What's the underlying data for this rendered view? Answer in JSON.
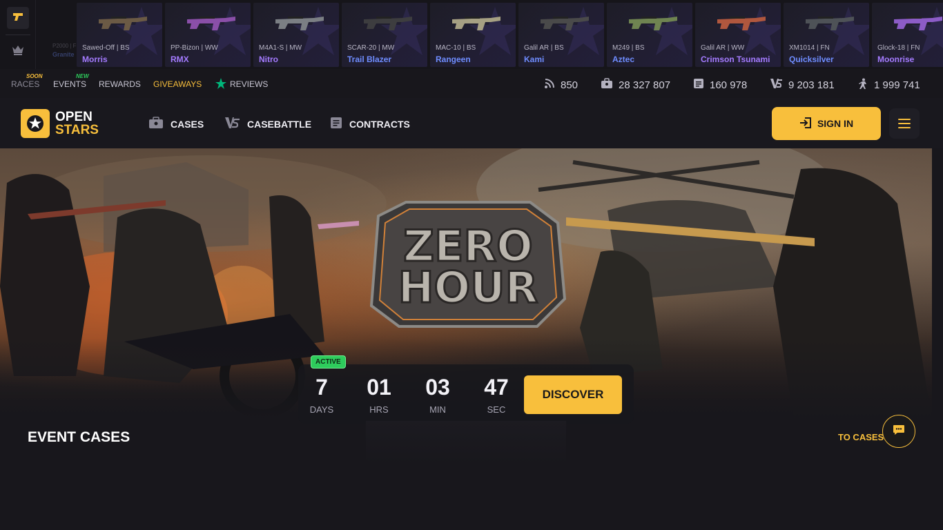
{
  "drops": [
    {
      "condition": "Sawed-Off | BS",
      "name": "Morris",
      "color": "#a47bff"
    },
    {
      "condition": "PP-Bizon | WW",
      "name": "RMX",
      "color": "#a47bff"
    },
    {
      "condition": "M4A1-S | MW",
      "name": "Nitro",
      "color": "#a47bff"
    },
    {
      "condition": "SCAR-20 | MW",
      "name": "Trail Blazer",
      "color": "#6f8dff"
    },
    {
      "condition": "MAC-10 | BS",
      "name": "Rangeen",
      "color": "#6f8dff"
    },
    {
      "condition": "Galil AR | BS",
      "name": "Kami",
      "color": "#6f8dff"
    },
    {
      "condition": "M249 | BS",
      "name": "Aztec",
      "color": "#6f8dff"
    },
    {
      "condition": "Galil AR | WW",
      "name": "Crimson Tsunami",
      "color": "#a47bff"
    },
    {
      "condition": "XM1014 | FN",
      "name": "Quicksilver",
      "color": "#6f8dff"
    },
    {
      "condition": "Glock-18 | FN",
      "name": "Moonrise",
      "color": "#a47bff"
    }
  ],
  "ghost_drop": {
    "text": "P2000 | F",
    "name": "Granite"
  },
  "subnav": {
    "races": "RACES",
    "races_tag": "SOON",
    "events": "EVENTS",
    "events_tag": "NEW",
    "rewards": "REWARDS",
    "giveaways": "GIVEAWAYS",
    "reviews": "REVIEWS"
  },
  "stats": {
    "online": "850",
    "cases_opened": "28 327 807",
    "contracts": "160 978",
    "battles": "9 203 181",
    "users": "1 999 741"
  },
  "header": {
    "logo_line1": "OPEN",
    "logo_line2": "STARS",
    "nav_cases": "CASES",
    "nav_casebattle": "CASEBATTLE",
    "nav_contracts": "CONTRACTS",
    "sign_in": "SIGN IN"
  },
  "banner": {
    "title_line1": "ZERO",
    "title_line2": "HOUR",
    "status": "ACTIVE",
    "days": "7",
    "days_label": "DAYS",
    "hours": "01",
    "hours_label": "HRS",
    "minutes": "03",
    "minutes_label": "MIN",
    "seconds": "47",
    "seconds_label": "SEC",
    "cta": "DISCOVER"
  },
  "section": {
    "title": "EVENT CASES",
    "link": "TO CASES"
  },
  "colors": {
    "accent": "#f8bf3c",
    "background": "#18171c",
    "active": "#2ecc5c",
    "giveaways": "#f8bf3c",
    "reviews_star": "#00b67a"
  }
}
